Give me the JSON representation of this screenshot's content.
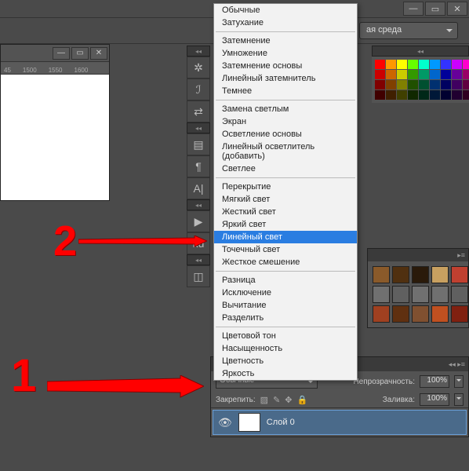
{
  "window": {
    "workspace_label": "ая среда"
  },
  "doc": {
    "ruler_marks": [
      "45",
      "1500",
      "1550",
      "1600"
    ]
  },
  "blend_menu": {
    "groups": [
      [
        "Обычные",
        "Затухание"
      ],
      [
        "Затемнение",
        "Умножение",
        "Затемнение основы",
        "Линейный затемнитель",
        "Темнее"
      ],
      [
        "Замена светлым",
        "Экран",
        "Осветление основы",
        "Линейный осветлитель (добавить)",
        "Светлее"
      ],
      [
        "Перекрытие",
        "Мягкий свет",
        "Жесткий свет",
        "Яркий свет",
        "Линейный свет",
        "Точечный свет",
        "Жесткое смешение"
      ],
      [
        "Разница",
        "Исключение",
        "Вычитание",
        "Разделить"
      ],
      [
        "Цветовой тон",
        "Насыщенность",
        "Цветность",
        "Яркость"
      ]
    ],
    "selected": "Линейный свет"
  },
  "layers": {
    "blend_mode": "Обычные",
    "opacity_label": "Непрозрачность:",
    "opacity_value": "100%",
    "lock_label": "Закрепить:",
    "fill_label": "Заливка:",
    "fill_value": "100%",
    "layer0": "Слой 0"
  },
  "annotations": {
    "one": "1",
    "two": "2"
  },
  "swatches_row1": [
    "#ff0000",
    "#ff9900",
    "#ffff00",
    "#66ff00",
    "#00ffcc",
    "#0099ff",
    "#3333ff",
    "#cc00ff",
    "#ff00cc"
  ],
  "swatches_row2": [
    "#cc0000",
    "#cc6600",
    "#cccc00",
    "#339900",
    "#009966",
    "#0066cc",
    "#000099",
    "#660099",
    "#990066"
  ],
  "swatches_row3": [
    "#800000",
    "#804000",
    "#808000",
    "#205000",
    "#005030",
    "#003070",
    "#000060",
    "#400060",
    "#600040"
  ],
  "swatches_row4": [
    "#400000",
    "#402000",
    "#404000",
    "#102800",
    "#002818",
    "#001838",
    "#000030",
    "#200030",
    "#300020"
  ],
  "styles_row1": [
    "#8a5a2a",
    "#503010",
    "#2a1a0a",
    "#c8a060",
    "#c04030"
  ],
  "styles_row2": [
    "#707070",
    "#606060",
    "#707070",
    "#707070",
    "#606060"
  ],
  "styles_row3": [
    "#a04020",
    "#603010",
    "#805030",
    "#c05020",
    "#802010"
  ]
}
